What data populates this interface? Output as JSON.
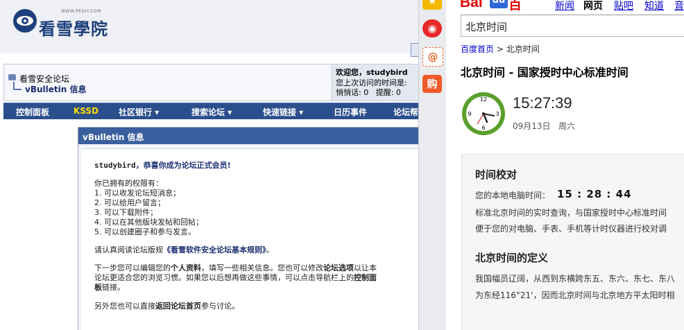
{
  "forum": {
    "logo_domain": "WWW.PEDIY.COM",
    "logo_text": "看雪學院",
    "breadcrumb": {
      "forum_name": "看雪安全论坛",
      "current": "vBulletin 信息"
    },
    "welcome": {
      "greeting": "欢迎您，studybird",
      "last_visit": "您上次访问的时间是:",
      "counts": "悄悄话: 0   提醒: 0"
    },
    "navbar": [
      "控制面板",
      "KSSD",
      "社区银行 ▾",
      "搜索论坛 ▾",
      "快速链接 ▾",
      "日历事件",
      "论坛帮"
    ],
    "dialog": {
      "title": "vBulletin 信息",
      "user": "studybird",
      "congrats": "，恭喜你成为论坛正式会员!",
      "perm_intro": "你已拥有的权限有：",
      "perms": [
        "1. 可以收发论坛短消息；",
        "2. 可以给用户留言；",
        "3. 可以下载附件；",
        "4. 可以在其他版块发帖和回帖；",
        "5. 可以创建圈子和参与发言。"
      ],
      "rules_prefix": "请认真阅读论坛版规",
      "rules_link": "《看雪软件安全论坛基本规则》",
      "rules_suffix": "。",
      "next_a": "下一步您可以编辑您的",
      "next_profile": "个人资料",
      "next_b": "，填写一些相关信息。您也可以修改",
      "next_options": "论坛选项",
      "next_c": "以让本",
      "next_line2": "论坛更适合您的浏览习惯。如果您以后想再做这些事情，可以点击导航栏上的",
      "next_panel1": "控制面",
      "next_panel2": "板",
      "next_line3": "链接。",
      "back_a": "另外您也可以直接",
      "back_link": "返回论坛首页",
      "back_b": "参与讨论。"
    }
  },
  "sidebar": {
    "buttons": [
      {
        "name": "favorite",
        "glyph": "★",
        "color": "#f5b800"
      },
      {
        "name": "weibo",
        "glyph": "◉",
        "color": "#e6282a"
      },
      {
        "name": "email",
        "glyph": "@",
        "color": "#e8672a"
      },
      {
        "name": "shop",
        "glyph": "购",
        "color": "#f05a28"
      }
    ]
  },
  "baidu": {
    "logo_a": "Bai",
    "logo_paw": "du",
    "logo_c": "百度",
    "nav": [
      "新闻",
      "网页",
      "贴吧",
      "知道",
      "音"
    ],
    "nav_current": "网页",
    "search_value": "北京时间",
    "breadcrumb_home": "百度首页",
    "breadcrumb_sep": " > ",
    "breadcrumb_cur": "北京时间",
    "result_title": "北京时间 - 国家授时中心标准时间",
    "time": "15:27:39",
    "date": "09月13日   周六",
    "card": {
      "h1": "时间校对",
      "local_label": "您的本地电脑时间：",
      "local_time": "15 : 28 : 44",
      "line1": "标准北京时间的实时查询，与国家授时中心标准时间",
      "line2": "便于您的对电脑、手表、手机等计时仪器进行校对调",
      "h2": "北京时间的定义",
      "line3": "我国幅员辽阔，从西到东横跨东五、东六、东七、东八",
      "line4": "为东经116°21'，因而北京时间与北京地方平太阳时相"
    },
    "clock_numbers": [
      "12",
      "3",
      "6",
      "9"
    ]
  }
}
